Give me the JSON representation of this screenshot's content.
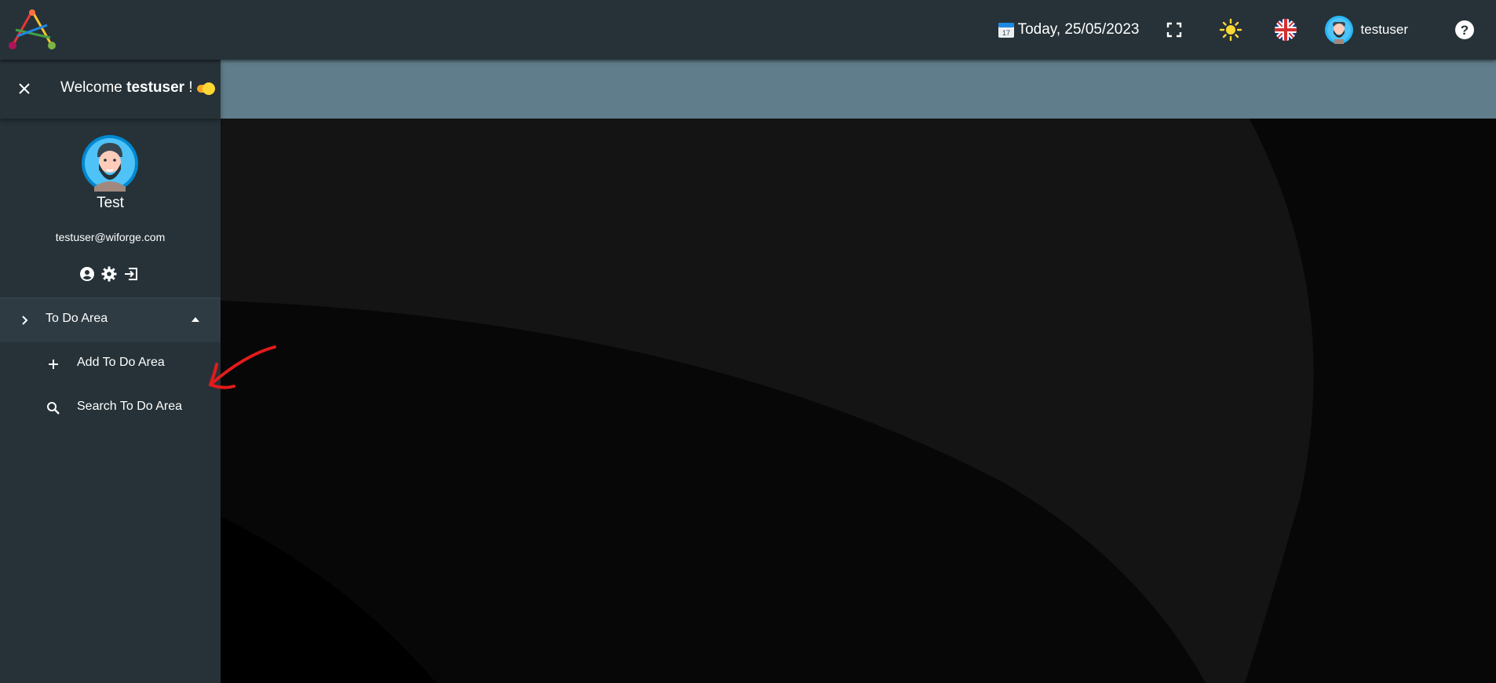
{
  "topbar": {
    "date_label": "Today, 25/05/2023",
    "username": "testuser",
    "icons": [
      "calendar-icon",
      "fullscreen-icon",
      "sun-icon",
      "uk-flag-icon",
      "avatar",
      "help-icon"
    ]
  },
  "sidebar": {
    "welcome_prefix": "Welcome ",
    "welcome_user": "testuser",
    "welcome_suffix": " !",
    "profile_name": "Test",
    "profile_email": "testuser@wiforge.com",
    "menu_group_label": "To Do Area",
    "sub_items": [
      {
        "label": "Add To Do Area",
        "icon": "plus-icon"
      },
      {
        "label": "Search To Do Area",
        "icon": "search-icon"
      }
    ]
  },
  "colors": {
    "topbar_bg": "#263238",
    "banner_bg": "#607d8b",
    "sidebar_bg": "#263238",
    "accent_yellow": "#fdd835",
    "annotation_red": "#e31b1b"
  }
}
